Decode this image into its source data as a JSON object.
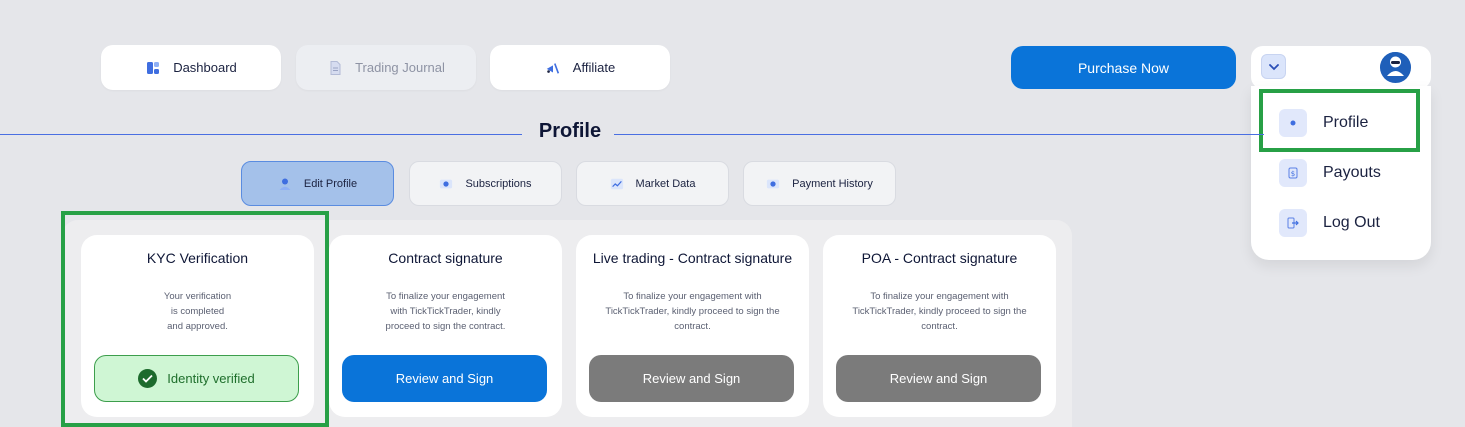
{
  "nav": {
    "items": [
      {
        "label": "Dashboard",
        "icon": "dashboard-icon",
        "enabled": true
      },
      {
        "label": "Trading Journal",
        "icon": "journal-icon",
        "enabled": false
      },
      {
        "label": "Affiliate",
        "icon": "affiliate-icon",
        "enabled": true
      }
    ],
    "purchase_label": "Purchase Now"
  },
  "user_menu": {
    "toggle_icon": "chevron-down-icon",
    "avatar_icon": "user-avatar-icon",
    "items": [
      {
        "label": "Profile",
        "icon": "profile-icon",
        "highlighted": true
      },
      {
        "label": "Payouts",
        "icon": "dollar-icon"
      },
      {
        "label": "Log Out",
        "icon": "logout-icon"
      }
    ]
  },
  "page": {
    "title": "Profile"
  },
  "tabs": [
    {
      "label": "Edit Profile",
      "icon": "user-icon",
      "active": true
    },
    {
      "label": "Subscriptions",
      "icon": "subscription-icon",
      "active": false
    },
    {
      "label": "Market Data",
      "icon": "chart-icon",
      "active": false
    },
    {
      "label": "Payment History",
      "icon": "payment-icon",
      "active": false
    }
  ],
  "cards": [
    {
      "title": "KYC Verification",
      "description": [
        "Your verification",
        "is completed",
        "and approved."
      ],
      "button_label": "Identity verified",
      "status": "verified",
      "highlighted": true
    },
    {
      "title": "Contract signature",
      "description": [
        "To finalize your engagement",
        "with TickTickTrader, kindly",
        "proceed to sign the contract."
      ],
      "button_label": "Review and Sign",
      "status": "action"
    },
    {
      "title": "Live trading - Contract signature",
      "description": [
        "To finalize your engagement with",
        "TickTickTrader, kindly proceed to sign the",
        "contract."
      ],
      "button_label": "Review and Sign",
      "status": "disabled"
    },
    {
      "title": "POA - Contract signature",
      "description": [
        "To finalize your engagement with",
        "TickTickTrader, kindly proceed to sign the",
        "contract."
      ],
      "button_label": "Review and Sign",
      "status": "disabled"
    }
  ],
  "colors": {
    "primary": "#0a74d9",
    "highlight": "#27a046",
    "verified_bg": "#cff6d4",
    "disabled_button": "#7b7b7b",
    "background": "#e5e6ea"
  }
}
